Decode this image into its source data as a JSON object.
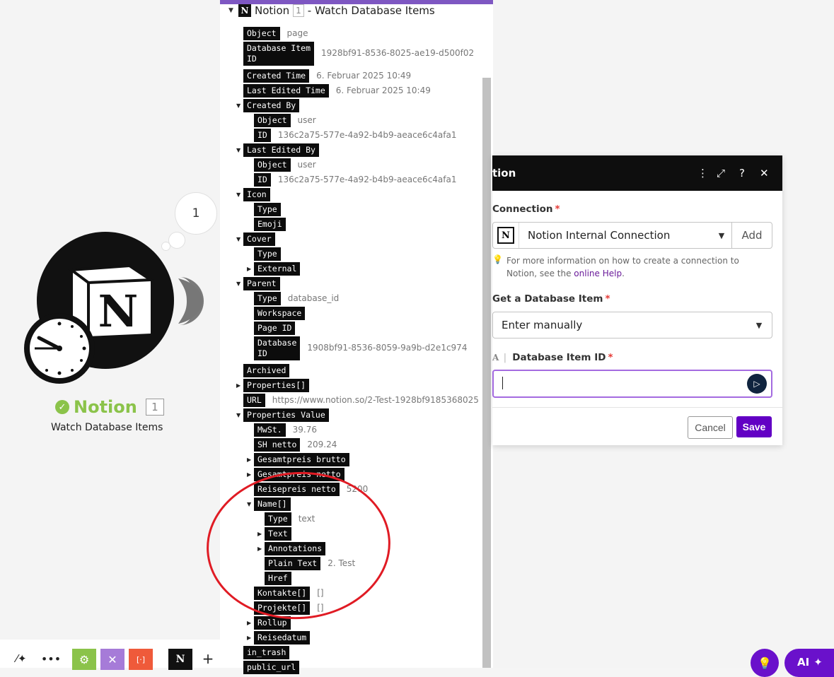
{
  "module": {
    "bubble_count": "1",
    "name": "Notion",
    "count": "1",
    "subtitle": "Watch Database Items"
  },
  "toolbar": {
    "notion_label": "N",
    "brackets_label": "[·]"
  },
  "panel": {
    "title": "Notion",
    "count": "1",
    "title_suffix": "- Watch Database Items",
    "rows": [
      {
        "key": "Object",
        "val": "page"
      },
      {
        "key": "Database Item\nID",
        "val": "1928bf91-8536-8025-ae19-d500f02"
      },
      {
        "key": "Created Time",
        "val": "6. Februar 2025 10:49"
      },
      {
        "key": "Last Edited Time",
        "val": "6. Februar 2025 10:49"
      },
      {
        "key": "Created By",
        "val": ""
      },
      {
        "key": "Object",
        "val": "user"
      },
      {
        "key": "ID",
        "val": "136c2a75-577e-4a92-b4b9-aeace6c4afa1"
      },
      {
        "key": "Last Edited By",
        "val": ""
      },
      {
        "key": "Object",
        "val": "user"
      },
      {
        "key": "ID",
        "val": "136c2a75-577e-4a92-b4b9-aeace6c4afa1"
      },
      {
        "key": "Icon",
        "val": ""
      },
      {
        "key": "Type",
        "val": ""
      },
      {
        "key": "Emoji",
        "val": ""
      },
      {
        "key": "Cover",
        "val": ""
      },
      {
        "key": "Type",
        "val": ""
      },
      {
        "key": "External",
        "val": ""
      },
      {
        "key": "Parent",
        "val": ""
      },
      {
        "key": "Type",
        "val": "database_id"
      },
      {
        "key": "Workspace",
        "val": ""
      },
      {
        "key": "Page ID",
        "val": ""
      },
      {
        "key": "Database\nID",
        "val": "1908bf91-8536-8059-9a9b-d2e1c974"
      },
      {
        "key": "Archived",
        "val": ""
      },
      {
        "key": "Properties[]",
        "val": ""
      },
      {
        "key": "URL",
        "val": "https://www.notion.so/2-Test-1928bf9185368025"
      },
      {
        "key": "Properties Value",
        "val": ""
      },
      {
        "key": "MwSt.",
        "val": "39.76"
      },
      {
        "key": "SH netto",
        "val": "209.24"
      },
      {
        "key": "Gesamtpreis brutto",
        "val": ""
      },
      {
        "key": "Gesamtpreis netto",
        "val": ""
      },
      {
        "key": "Reisepreis netto",
        "val": "5200"
      },
      {
        "key": "Name[]",
        "val": ""
      },
      {
        "key": "Type",
        "val": "text"
      },
      {
        "key": "Text",
        "val": ""
      },
      {
        "key": "Annotations",
        "val": ""
      },
      {
        "key": "Plain Text",
        "val": "2. Test"
      },
      {
        "key": "Href",
        "val": ""
      },
      {
        "key": "Kontakte[]",
        "val": "[]"
      },
      {
        "key": "Projekte[]",
        "val": "[]"
      },
      {
        "key": "Rollup",
        "val": ""
      },
      {
        "key": "Reisedatum",
        "val": ""
      },
      {
        "key": "in_trash",
        "val": ""
      },
      {
        "key": "public_url",
        "val": ""
      }
    ]
  },
  "dialog": {
    "title": "tion",
    "connection_label": "Connection",
    "connection_value": "Notion Internal Connection",
    "add_label": "Add",
    "hint_text": "For more information on how to create a connection to Notion, see the ",
    "hint_link": "online Help",
    "hint_end": ".",
    "get_item_label": "Get a Database Item",
    "get_item_value": "Enter manually",
    "item_id_label": "Database Item ID",
    "item_id_value": "",
    "cancel_label": "Cancel",
    "save_label": "Save",
    "required_mark": "*"
  },
  "bottom_right": {
    "ai_label": "AI"
  },
  "colors": {
    "accent": "#6200c4",
    "success": "#8bc34a",
    "annotation": "#e01b24"
  }
}
